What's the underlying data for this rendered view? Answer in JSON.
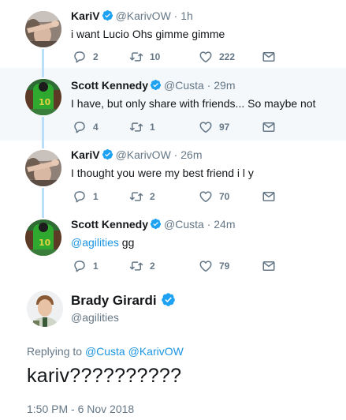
{
  "thread": [
    {
      "name": "KariV",
      "handle": "@KarivOW",
      "separator": " · ",
      "time": "1h",
      "text": "i want Lucio Ohs gimme gimme",
      "replies": "2",
      "retweets": "10",
      "likes": "222"
    },
    {
      "name": "Scott Kennedy",
      "handle": "@Custa",
      "separator": " · ",
      "time": "29m",
      "text": "I have, but only share with friends... So maybe not",
      "replies": "4",
      "retweets": "1",
      "likes": "97"
    },
    {
      "name": "KariV",
      "handle": "@KarivOW",
      "separator": " · ",
      "time": "26m",
      "text": "I thought you were my best friend i l y",
      "replies": "1",
      "retweets": "2",
      "likes": "70"
    },
    {
      "name": "Scott Kennedy",
      "handle": "@Custa",
      "separator": " · ",
      "time": "24m",
      "mention": "@agilities",
      "text": " gg",
      "replies": "1",
      "retweets": "2",
      "likes": "79"
    }
  ],
  "main_tweet": {
    "name": "Brady Girardi",
    "handle": "@agilities",
    "replying_prefix": "Replying to ",
    "replying_to_1": "@Custa",
    "replying_to_2": "@KarivOW",
    "text": "kariv??????????",
    "timestamp": "1:50 PM - 6 Nov 2018"
  },
  "colors": {
    "accent": "#1da1f2",
    "link": "#1b95e0",
    "muted": "#657786",
    "highlight_bg": "#f5f8fa",
    "thread_line": "#b9dffa"
  },
  "icons": [
    "reply-icon",
    "retweet-icon",
    "like-icon",
    "direct-message-icon",
    "verified-badge-icon"
  ]
}
